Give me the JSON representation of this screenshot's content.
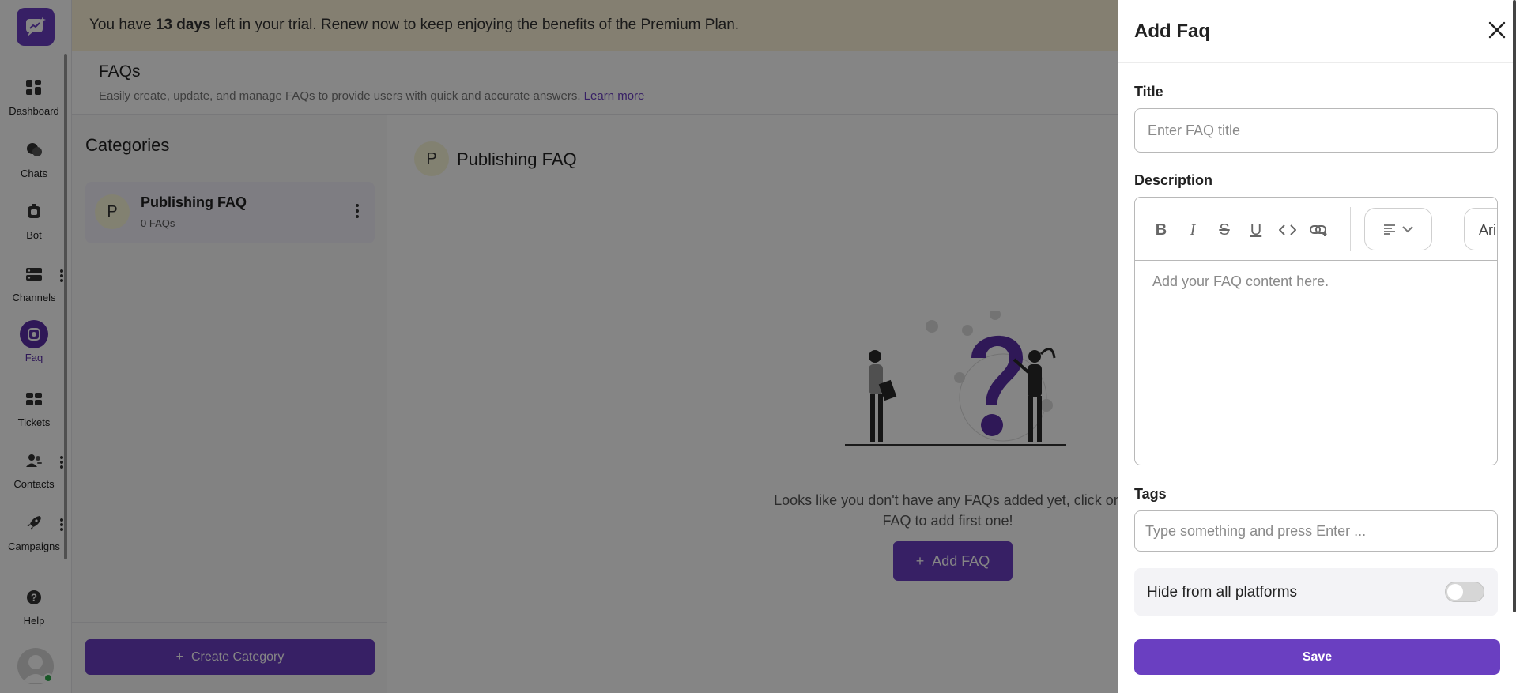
{
  "banner": {
    "pre": "You have ",
    "days": "13 days",
    "post": " left in your trial. Renew now to keep enjoying the benefits of the Premium Plan."
  },
  "nav": {
    "items": [
      {
        "label": "Dashboard",
        "icon": "dashboard-icon"
      },
      {
        "label": "Chats",
        "icon": "chats-icon"
      },
      {
        "label": "Bot",
        "icon": "bot-icon"
      },
      {
        "label": "Channels",
        "icon": "channels-icon"
      },
      {
        "label": "Faq",
        "icon": "faq-icon",
        "active": true
      },
      {
        "label": "Tickets",
        "icon": "tickets-icon"
      },
      {
        "label": "Contacts",
        "icon": "contacts-icon"
      },
      {
        "label": "Campaigns",
        "icon": "campaigns-icon"
      },
      {
        "label": "Help",
        "icon": "help-icon"
      }
    ]
  },
  "page": {
    "title": "FAQs",
    "subtitle": "Easily create, update, and manage FAQs to provide users with quick and accurate answers.",
    "learn_more": "Learn more"
  },
  "categories": {
    "heading": "Categories",
    "items": [
      {
        "letter": "P",
        "name": "Publishing FAQ",
        "count": "0 FAQs"
      }
    ],
    "create_label": "Create Category"
  },
  "content": {
    "letter": "P",
    "title": "Publishing FAQ",
    "empty_line1": "Looks like you don't have any FAQs added yet, click on",
    "empty_line2": "FAQ to add first one!",
    "add_label": "Add FAQ"
  },
  "drawer": {
    "title": "Add Faq",
    "title_label": "Title",
    "title_placeholder": "Enter FAQ title",
    "description_label": "Description",
    "toolbar_font": "Ari",
    "description_placeholder": "Add your FAQ content here.",
    "tags_label": "Tags",
    "tags_placeholder": "Type something and press Enter ...",
    "hide_label": "Hide from all platforms",
    "hide_enabled": false,
    "save_label": "Save"
  },
  "colors": {
    "accent": "#6a3fc1",
    "banner_bg": "#fdf3d8",
    "status_online": "#2ea84a"
  }
}
